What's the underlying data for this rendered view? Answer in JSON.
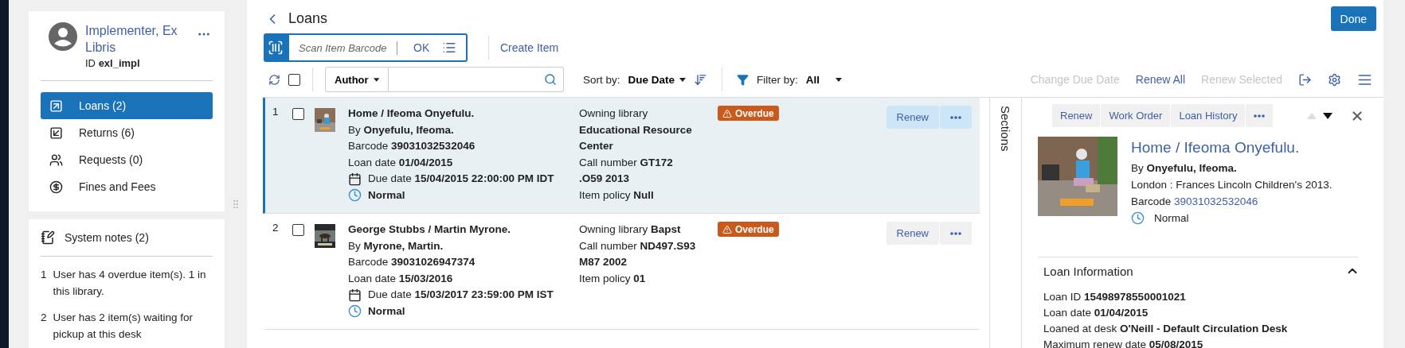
{
  "user": {
    "name": "Implementer, Ex Libris",
    "id_label": "ID",
    "id": "exl_impl"
  },
  "nav": [
    {
      "kind": "loans",
      "label": "Loans (2)",
      "selected": true
    },
    {
      "kind": "returns",
      "label": "Returns (6)",
      "selected": false
    },
    {
      "kind": "requests",
      "label": "Requests (0)",
      "selected": false
    },
    {
      "kind": "fines",
      "label": "Fines and Fees",
      "selected": false
    }
  ],
  "system_notes": {
    "title": "System notes (2)",
    "notes": [
      {
        "number": "1",
        "text": "User has 4 overdue item(s). 1 in this library."
      },
      {
        "number": "2",
        "text": "User has 2 item(s) waiting for pickup at this desk"
      }
    ]
  },
  "page": {
    "title": "Loans",
    "done_button": "Done"
  },
  "scan": {
    "placeholder": "Scan Item Barcode",
    "ok_button": "OK",
    "create_item": "Create Item"
  },
  "toolbar": {
    "select_all_checked": false,
    "search_field_menu": "Author",
    "sort_label": "Sort by:",
    "sort_value": "Due Date",
    "filter_label": "Filter by:",
    "filter_value": "All",
    "actions": [
      {
        "label": "Change Due Date",
        "disabled": true
      },
      {
        "label": "Renew All",
        "disabled": false
      },
      {
        "label": "Renew Selected",
        "disabled": true
      }
    ]
  },
  "loans": [
    {
      "number": "1",
      "selected": true,
      "checked": false,
      "title": "Home / Ifeoma Onyefulu.",
      "author": "By **Onyefulu, Ifeoma.**",
      "barcode": "Barcode **39031032532046**",
      "loan_date": "Loan date **01/04/2015**",
      "due_date": "Due date **15/04/2015 22:00:00 PM IDT**",
      "status": "Normal",
      "owning_library": "Owning library **Educational Resource Center**",
      "call_number": "Call number **GT172 .O59 2013**",
      "item_policy": "Item policy **Null**",
      "badge": "Overdue",
      "renew_button": "Renew"
    },
    {
      "number": "2",
      "selected": false,
      "checked": false,
      "title": "George Stubbs / Martin Myrone.",
      "author": "By **Myrone, Martin.**",
      "barcode": "Barcode **39031026947374**",
      "loan_date": "Loan date **15/03/2016**",
      "due_date": "Due date **15/03/2017 23:59:00 PM IST**",
      "status": "Normal",
      "owning_library": "Owning library **Bapst**",
      "call_number": "Call number **ND497.S93 M87 2002**",
      "item_policy": "Item policy **01**",
      "badge": "Overdue",
      "renew_button": "Renew"
    }
  ],
  "details": {
    "sections_label": "Sections",
    "actions": [
      "Renew",
      "Work Order",
      "Loan History"
    ],
    "prev_disabled": true,
    "next_disabled": false,
    "title": "Home / Ifeoma Onyefulu.",
    "author": "By **Onyefulu, Ifeoma.**",
    "publisher": "London : Frances Lincoln Children's 2013.",
    "barcode_label": "Barcode",
    "barcode": "39031032532046",
    "status": "Normal",
    "loan_info": {
      "title": "Loan Information",
      "expanded": true,
      "fields": [
        "Loan ID **15498978550001021**",
        "Loan date **01/04/2015**",
        "Loaned at desk **O'Neill - Default Circulation Desk**",
        "Maximum renew date **05/08/2015**"
      ]
    }
  }
}
